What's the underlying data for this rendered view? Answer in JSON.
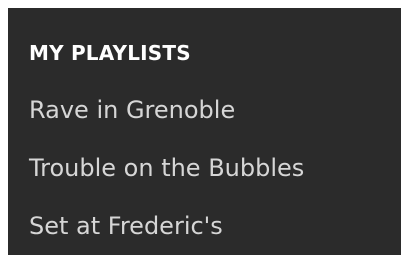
{
  "playlists": {
    "header": "MY PLAYLISTS",
    "items": [
      {
        "label": "Rave in Grenoble"
      },
      {
        "label": "Trouble on the Bubbles"
      },
      {
        "label": "Set at Frederic's"
      }
    ]
  },
  "colors": {
    "panel_background": "#2b2b2b",
    "header_text": "#ffffff",
    "item_text": "#d6d6d6"
  }
}
